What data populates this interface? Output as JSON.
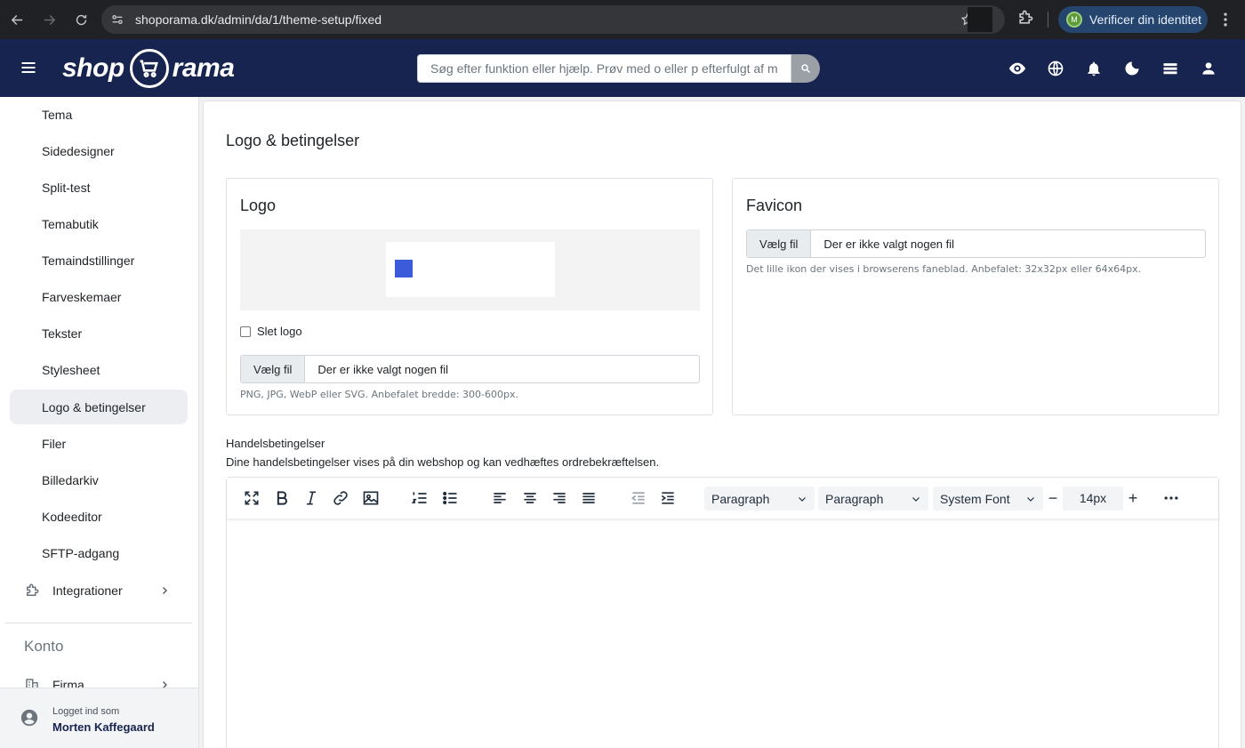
{
  "browser": {
    "url": "shoporama.dk/admin/da/1/theme-setup/fixed",
    "verify_avatar": "M",
    "verify_label": "Verificer din identitet"
  },
  "header": {
    "logo_left": "shop",
    "logo_right": "rama",
    "search_placeholder": "Søg efter funktion eller hjælp. Prøv med o eller p efterfulgt af mellemrum",
    "icons": [
      "eye-icon",
      "globe-icon",
      "bell-icon",
      "moon-icon",
      "layers-icon",
      "user-icon"
    ]
  },
  "sidebar": {
    "items": [
      {
        "label": "Tema"
      },
      {
        "label": "Sidedesigner"
      },
      {
        "label": "Split-test"
      },
      {
        "label": "Temabutik"
      },
      {
        "label": "Temaindstillinger"
      },
      {
        "label": "Farveskemaer"
      },
      {
        "label": "Tekster"
      },
      {
        "label": "Stylesheet"
      },
      {
        "label": "Logo & betingelser"
      },
      {
        "label": "Filer"
      },
      {
        "label": "Billedarkiv"
      },
      {
        "label": "Kodeeditor"
      },
      {
        "label": "SFTP-adgang"
      }
    ],
    "active_index": 8,
    "integrations_label": "Integrationer",
    "section_label": "Konto",
    "company_label": "Firma",
    "logged_in_label": "Logget ind som",
    "user_name": "Morten Kaffegaard"
  },
  "main": {
    "title": "Logo & betingelser",
    "logo_card": {
      "title": "Logo",
      "delete_label": "Slet logo",
      "file_button": "Vælg fil",
      "file_status": "Der er ikke valgt nogen fil",
      "help": "PNG, JPG, WebP eller SVG. Anbefalet bredde: 300-600px."
    },
    "favicon_card": {
      "title": "Favicon",
      "file_button": "Vælg fil",
      "file_status": "Der er ikke valgt nogen fil",
      "help": "Det lille ikon der vises i browserens faneblad. Anbefalet: 32x32px eller 64x64px."
    },
    "terms_label": "Handelsbetingelser",
    "terms_description": "Dine handelsbetingelser vises på din webshop og kan vedhæftes ordrebekræftelsen.",
    "editor": {
      "block_format": "Paragraph",
      "block_format_2": "Paragraph",
      "font_family": "System Font",
      "font_size": "14px"
    }
  }
}
